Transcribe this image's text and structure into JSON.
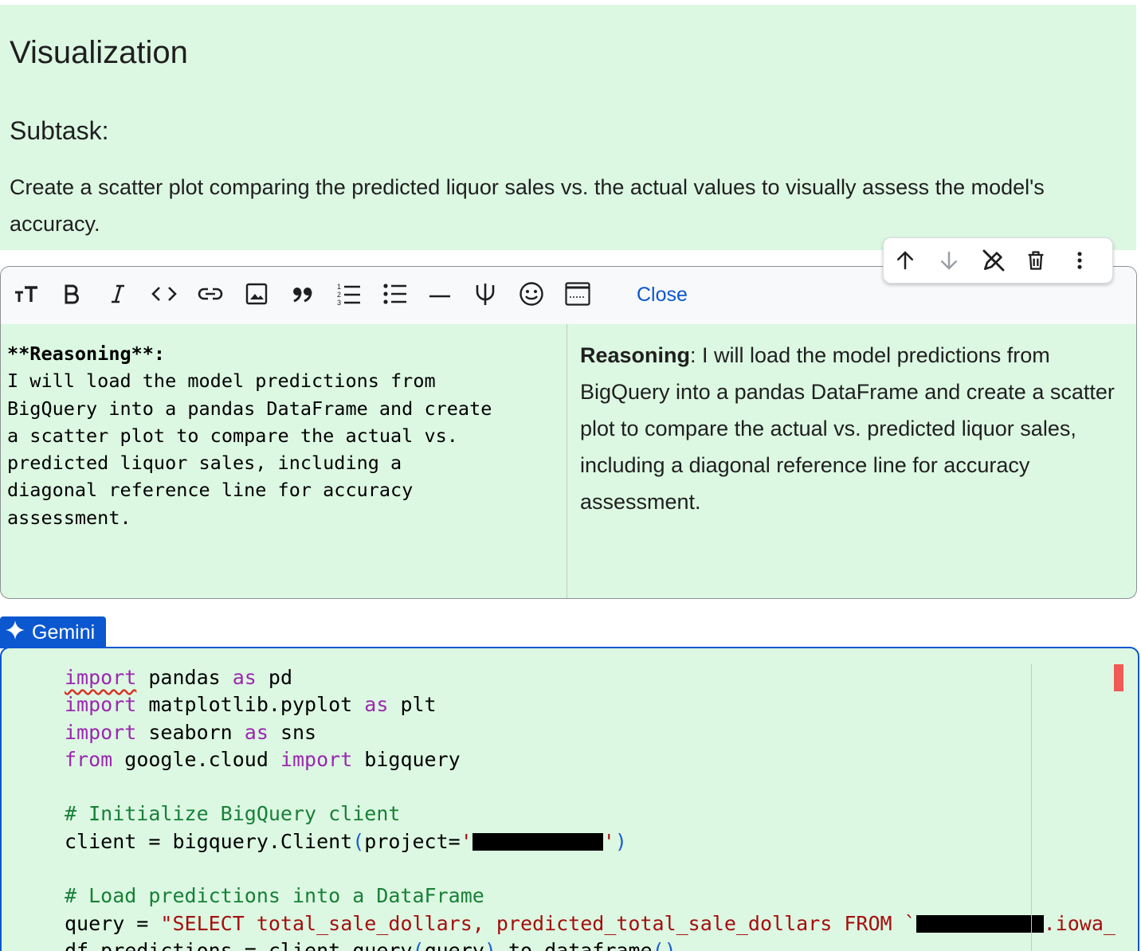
{
  "markdown_cell": {
    "heading": "Visualization",
    "subheading": "Subtask:",
    "description": "Create a scatter plot comparing the predicted liquor sales vs. the actual values to visually assess the model's accuracy."
  },
  "cell_toolbar": {
    "icons": [
      "arrow-up-icon",
      "arrow-down-icon",
      "edit-off-icon",
      "trash-icon",
      "more-vert-icon"
    ]
  },
  "format_toolbar": {
    "icons": [
      "text-size-icon",
      "bold-icon",
      "italic-icon",
      "code-icon",
      "link-icon",
      "image-icon",
      "quote-icon",
      "numbered-list-icon",
      "bulleted-list-icon",
      "horizontal-rule-icon",
      "latex-icon",
      "emoji-icon",
      "preview-toggle-icon"
    ],
    "close_label": "Close"
  },
  "editor": {
    "source_heading": "**Reasoning**:",
    "source_lines": [
      "I will load the model predictions from",
      "BigQuery into a pandas DataFrame and create",
      "a scatter plot to compare the actual vs.",
      "predicted liquor sales, including a",
      "diagonal reference line for accuracy",
      "assessment."
    ],
    "preview_bold": "Reasoning",
    "preview_text": ": I will load the model predictions from BigQuery into a pandas DataFrame and create a scatter plot to compare the actual vs. predicted liquor sales, including a diagonal reference line for accuracy assessment."
  },
  "gemini_tab": {
    "label": "Gemini",
    "icon": "sparkle-icon",
    "accent": "#0b57d0"
  },
  "code": {
    "line1": {
      "kw1": "import",
      "t1": " pandas ",
      "kw2": "as",
      "t2": " pd"
    },
    "line2": {
      "kw1": "import",
      "t1": " matplotlib.pyplot ",
      "kw2": "as",
      "t2": " plt"
    },
    "line3": {
      "kw1": "import",
      "t1": " seaborn ",
      "kw2": "as",
      "t2": " sns"
    },
    "line4": {
      "kw1": "from",
      "t1": " google.cloud ",
      "kw2": "import",
      "t2": " bigquery"
    },
    "comment1": "# Initialize BigQuery client",
    "line6": {
      "t1": "client = bigquery.Client",
      "p1": "(",
      "t2": "project=",
      "s1": "'",
      "s2": "'",
      "p2": ")"
    },
    "comment2": "# Load predictions into a DataFrame",
    "line8": {
      "t1": "query = ",
      "s1": "\"SELECT total_sale_dollars, predicted_total_sale_dollars FROM `",
      "s2": ".iowa_"
    },
    "line9": {
      "t1": "df_predictions = client.query",
      "p1": "(",
      "t2": "query",
      "p2": ")",
      "t3": ".to_dataframe",
      "p3": "()"
    }
  }
}
